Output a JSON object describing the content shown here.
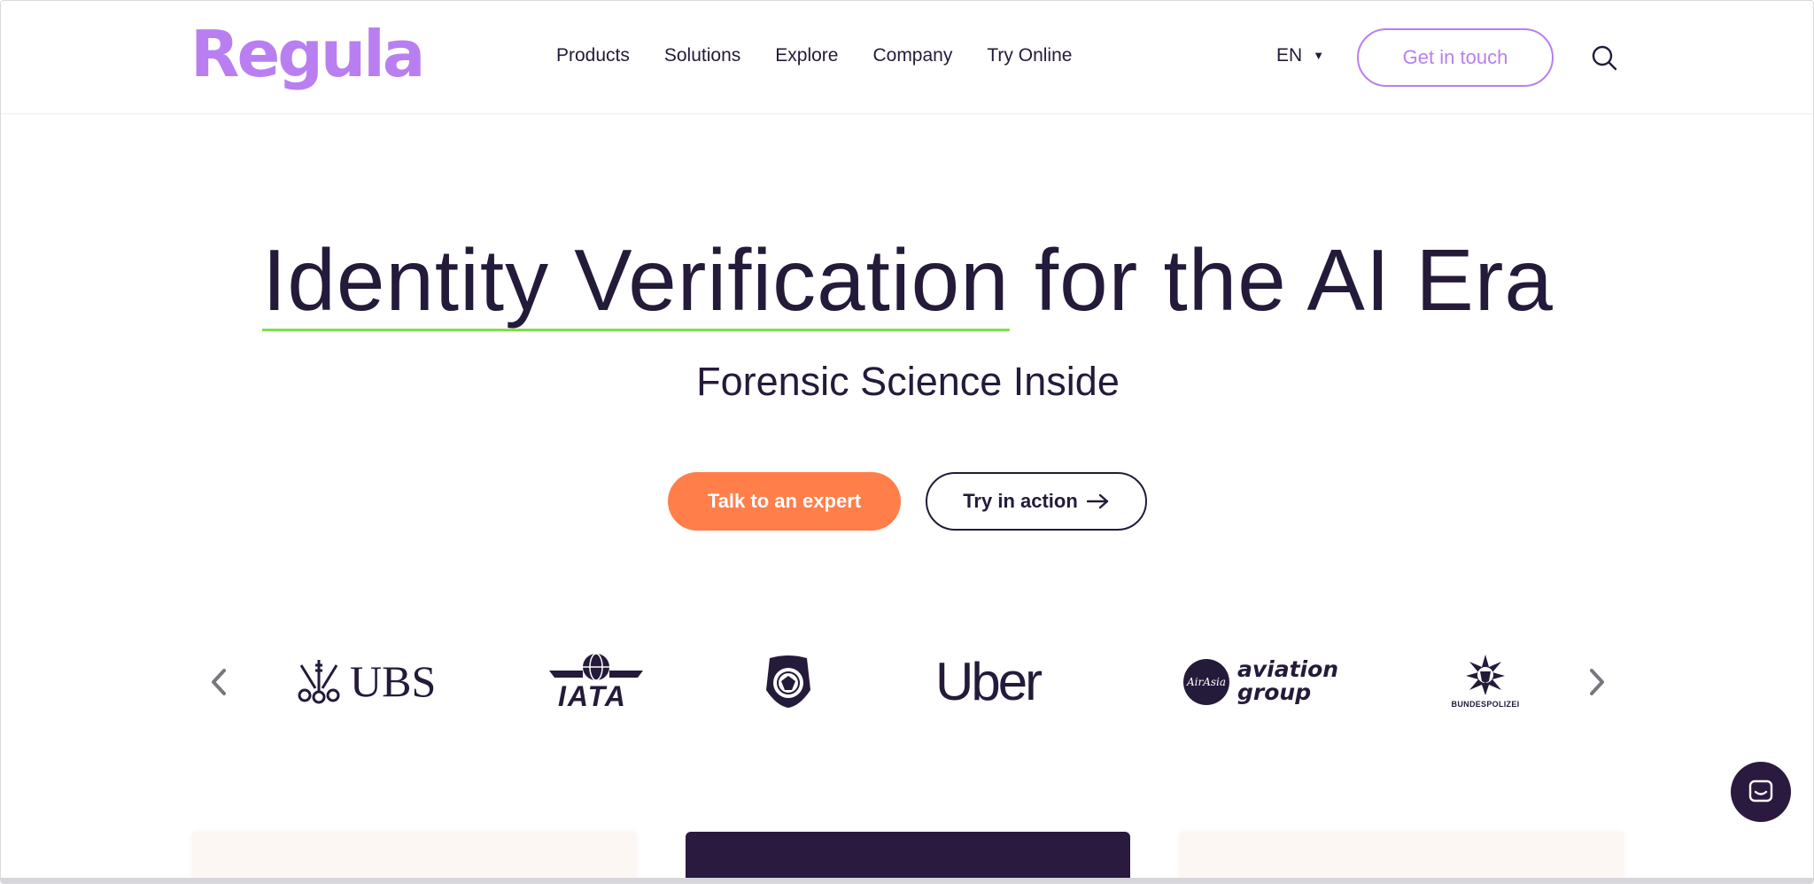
{
  "brand": {
    "logo_text": "Regula",
    "color": "#b97ff0"
  },
  "nav": {
    "items": [
      {
        "label": "Products"
      },
      {
        "label": "Solutions"
      },
      {
        "label": "Explore"
      },
      {
        "label": "Company"
      },
      {
        "label": "Try Online"
      }
    ]
  },
  "header": {
    "language": "EN",
    "cta_label": "Get in touch",
    "search_icon": "search-icon"
  },
  "hero": {
    "title_highlight": "Identity Verification",
    "title_rest": " for the AI Era",
    "subtitle": "Forensic Science Inside",
    "primary_cta": "Talk to an expert",
    "secondary_cta": "Try in action",
    "accent_color": "#ff7e4a",
    "underline_color": "#7ee04a"
  },
  "clients": {
    "logos": [
      {
        "name": "UBS",
        "text": "UBS"
      },
      {
        "name": "IATA",
        "text": "IATA"
      },
      {
        "name": "U.S. Customs and Border Protection",
        "text": ""
      },
      {
        "name": "Uber",
        "text": "Uber"
      },
      {
        "name": "AirAsia aviation group",
        "badge": "AirAsia",
        "line1": "aviation",
        "line2": "group"
      },
      {
        "name": "Bundespolizei",
        "text": "BUNDESPOLIZEI"
      }
    ]
  },
  "colors": {
    "text": "#241a3a",
    "dark_card": "#2b1a3f",
    "light_card": "#fdf7f4"
  }
}
